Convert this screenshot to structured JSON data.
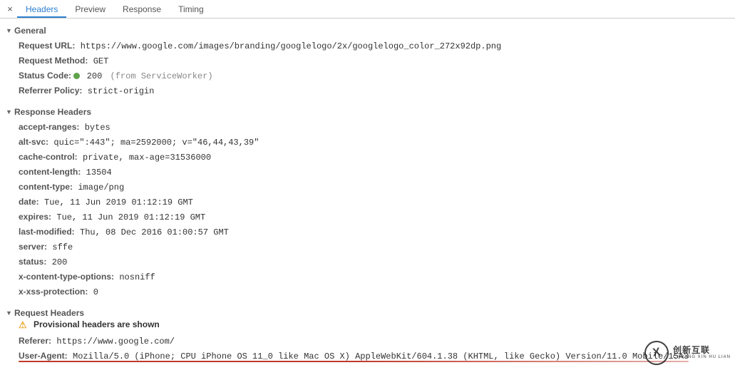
{
  "tabs": {
    "close": "×",
    "items": [
      "Headers",
      "Preview",
      "Response",
      "Timing"
    ],
    "active": 0
  },
  "sections": {
    "general": {
      "title": "General",
      "items": [
        {
          "k": "Request URL:",
          "v": "https://www.google.com/images/branding/googlelogo/2x/googlelogo_color_272x92dp.png"
        },
        {
          "k": "Request Method:",
          "v": "GET"
        },
        {
          "k": "Status Code:",
          "status": true,
          "v": "200",
          "suffix": "   (from ServiceWorker)"
        },
        {
          "k": "Referrer Policy:",
          "v": "strict-origin"
        }
      ]
    },
    "responseHeaders": {
      "title": "Response Headers",
      "items": [
        {
          "k": "accept-ranges:",
          "v": "bytes"
        },
        {
          "k": "alt-svc:",
          "v": "quic=\":443\"; ma=2592000; v=\"46,44,43,39\""
        },
        {
          "k": "cache-control:",
          "v": "private, max-age=31536000"
        },
        {
          "k": "content-length:",
          "v": "13504"
        },
        {
          "k": "content-type:",
          "v": "image/png"
        },
        {
          "k": "date:",
          "v": "Tue, 11 Jun 2019 01:12:19 GMT"
        },
        {
          "k": "expires:",
          "v": "Tue, 11 Jun 2019 01:12:19 GMT"
        },
        {
          "k": "last-modified:",
          "v": "Thu, 08 Dec 2016 01:00:57 GMT"
        },
        {
          "k": "server:",
          "v": "sffe"
        },
        {
          "k": "status:",
          "v": "200"
        },
        {
          "k": "x-content-type-options:",
          "v": "nosniff"
        },
        {
          "k": "x-xss-protection:",
          "v": "0"
        }
      ]
    },
    "requestHeaders": {
      "title": "Request Headers",
      "warning": "Provisional headers are shown",
      "items": [
        {
          "k": "Referer:",
          "v": "https://www.google.com/"
        },
        {
          "k": "User-Agent:",
          "v": "Mozilla/5.0 (iPhone; CPU iPhone OS 11_0 like Mac OS X) AppleWebKit/604.1.38 (KHTML, like Gecko) Version/11.0 Mobile/15A3",
          "highlight": true
        }
      ]
    }
  },
  "logo": {
    "mark": "X",
    "line1": "创新互联",
    "line2": "CHUANG XIN HU LIAN"
  }
}
